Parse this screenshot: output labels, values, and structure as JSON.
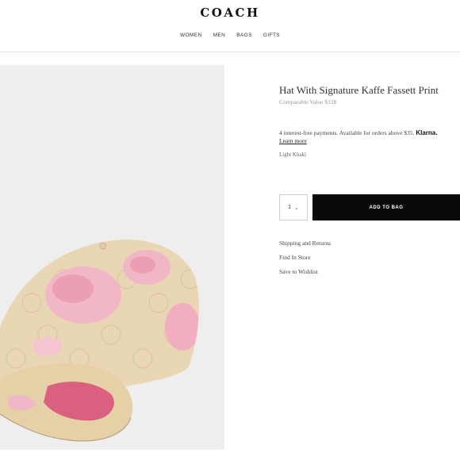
{
  "header": {
    "logo": "COACH",
    "nav": [
      "WOMEN",
      "MEN",
      "BAGS",
      "GIFTS"
    ]
  },
  "product": {
    "title": "Hat With Signature Kaffe Fassett Print",
    "comparable_value": "Comparable Value $128",
    "klarna": {
      "text": "4 interest-free payments. Available for orders above $35.",
      "brand": "Klarna.",
      "learn_more": "Learn more"
    },
    "color": "Light Khaki",
    "quantity": "1",
    "add_to_bag": "ADD TO BAG",
    "links": {
      "shipping": "Shipping and Returns",
      "find_in_store": "Find In Store",
      "wishlist": "Save to Wishlist"
    },
    "image_colors": {
      "background": "#eeeeee",
      "cap_base": "#e9d6b4",
      "flower_pink": "#f2b7c6",
      "flower_dark": "#d9607e"
    }
  }
}
